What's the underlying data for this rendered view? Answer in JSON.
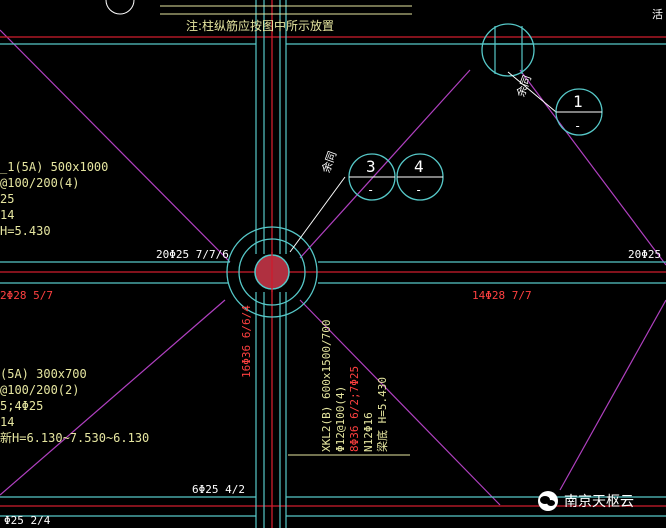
{
  "notes": {
    "top_note": "注:柱纵筋应按图中所示放置"
  },
  "colors": {
    "background": "#000000",
    "axis_red": "#d01c2c",
    "beam_cyan": "#56c8c8",
    "magenta_diag": "#b040c0",
    "text_yellow": "#e6e6a0",
    "text_red": "#ff4040",
    "text_white": "#ffffff",
    "column_fill": "#b03040"
  },
  "labels": {
    "beam_top_left_20": "20Φ25 7/7/6",
    "beam_top_right_20": "20Φ25",
    "beam_red_left": "2Φ28 5/7",
    "beam_red_mid": "14Φ28 7/7",
    "beam_bottom_6": "6Φ25 4/2",
    "beam_bottom_left": "Φ25 2/4",
    "column_vertical_red": "16Φ36 6/6/4",
    "yu_tong_1": "余同",
    "yu_tong_2": "余同",
    "circle_1": "1",
    "circle_3": "3",
    "circle_4": "4",
    "dash": "-",
    "dash_3": "-",
    "dash_4": "-"
  },
  "left_beam_upper": {
    "l1": "_1(5A) 500x1000",
    "l2": "@100/200(4)",
    "l3": "25",
    "l4": "14",
    "l5": "H=5.430"
  },
  "left_beam_lower": {
    "l1": "(5A) 300x700",
    "l2": "@100/200(2)",
    "l3": "5;4Φ25",
    "l4": "14",
    "l5": "新H=6.130~7.530~6.130"
  },
  "xkl": {
    "l1": "XKL2(B) 600x1500/700",
    "l2": "Φ12@100(4)",
    "l3": "8Φ36 6/2;7Φ25",
    "l4": "N12Φ16",
    "l5": "梁底 H=5.430"
  },
  "watermark": {
    "text": "南京天枢云",
    "icon": "wechat-icon"
  }
}
